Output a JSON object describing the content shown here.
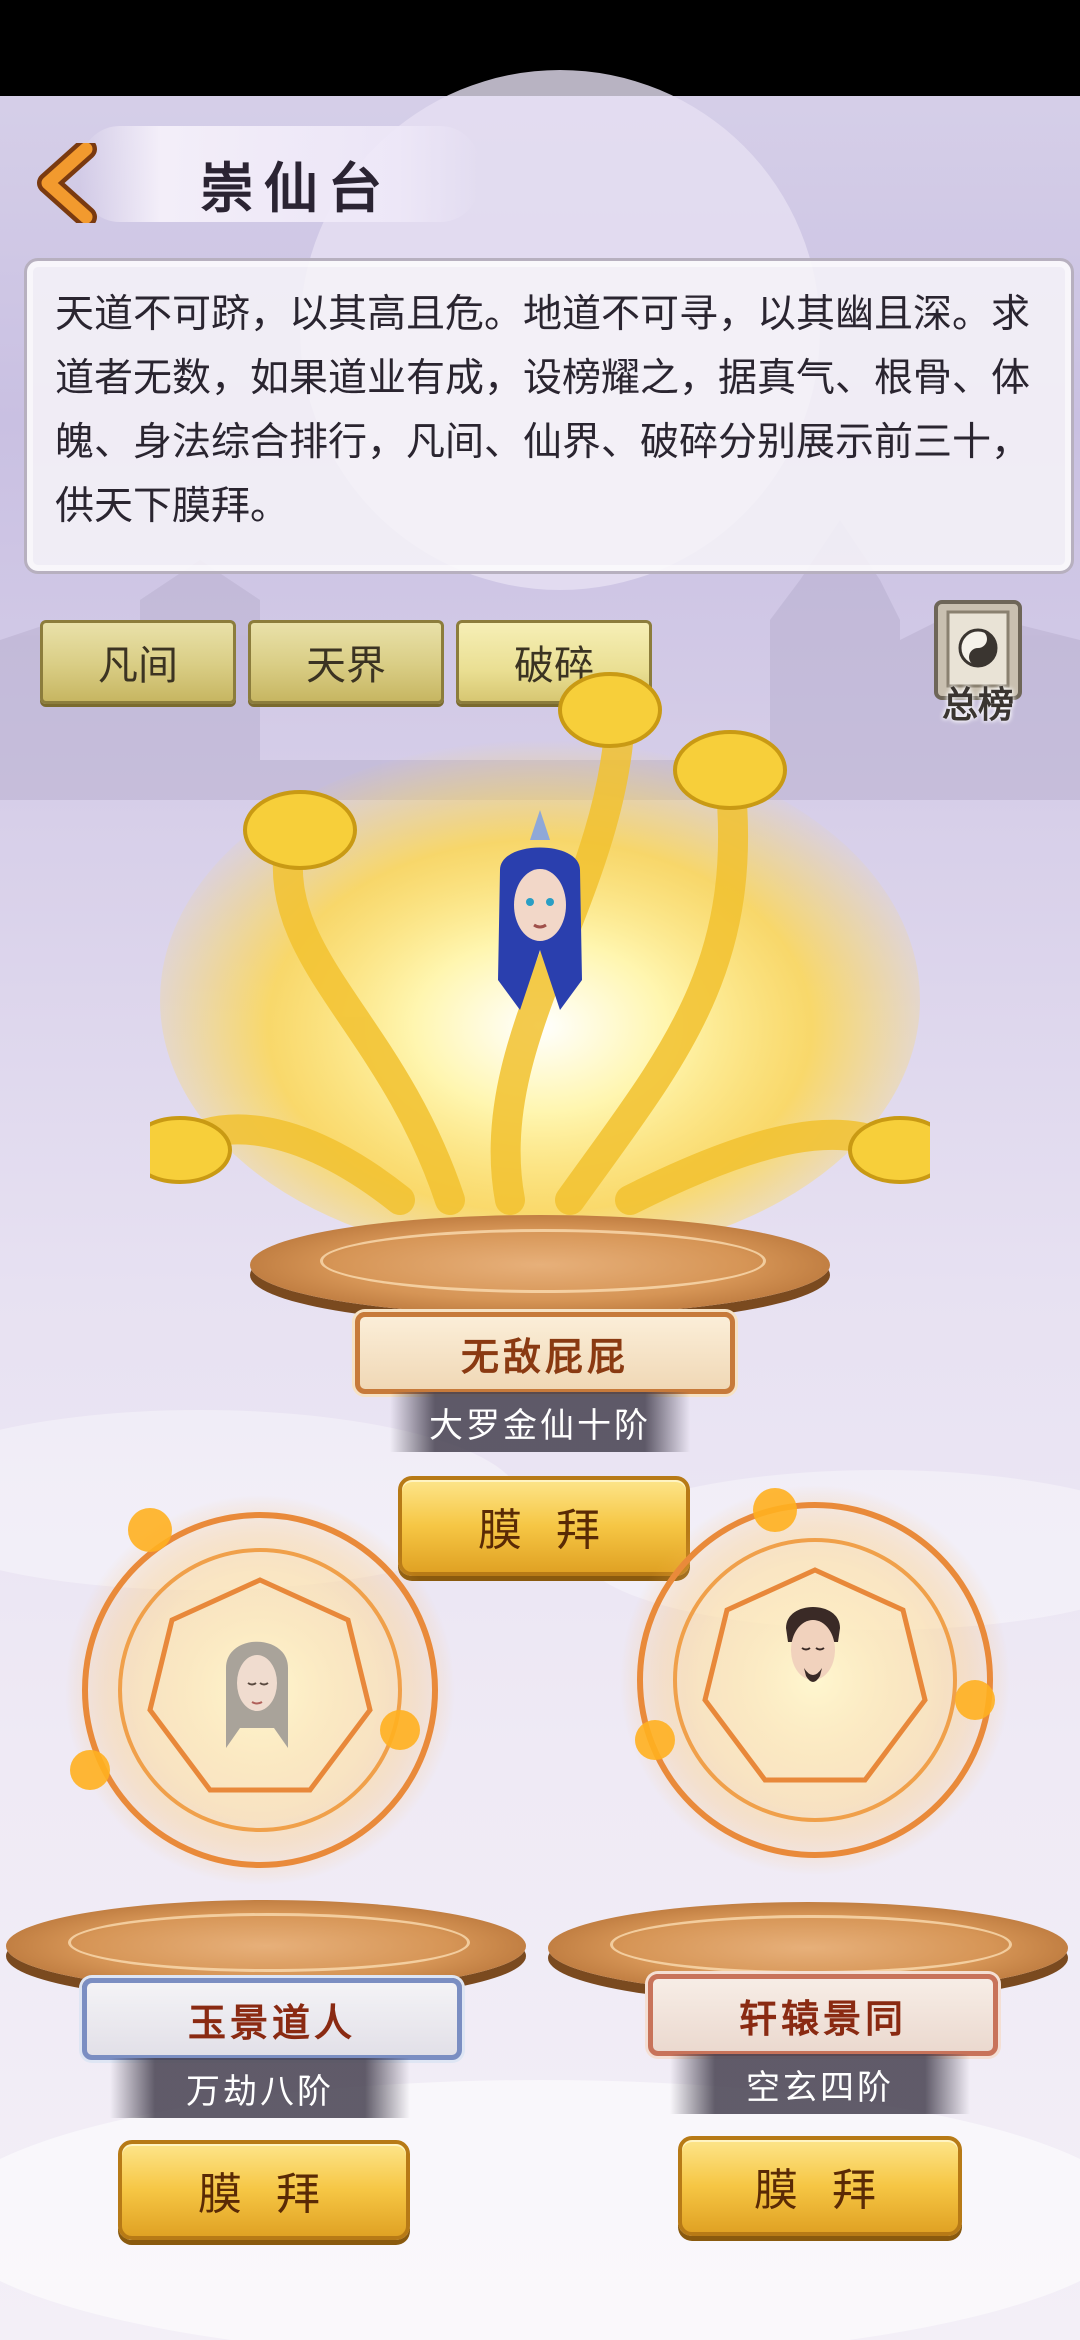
{
  "header": {
    "title": "崇仙台"
  },
  "description": "天道不可跻，以其高且危。地道不可寻，以其幽且深。求道者无数，如果道业有成，设榜耀之，据真气、根骨、体魄、身法综合排行，凡间、仙界、破碎分别展示前三十，供天下膜拜。",
  "tabs": [
    {
      "label": "凡间"
    },
    {
      "label": "天界"
    },
    {
      "label": "破碎"
    }
  ],
  "overall_button": {
    "label": "总榜"
  },
  "rank1": {
    "name": "无敌屁屁",
    "rank": "大罗金仙十阶",
    "button": "膜 拜"
  },
  "rank2": {
    "name": "玉景道人",
    "rank": "万劫八阶",
    "button": "膜 拜"
  },
  "rank3": {
    "name": "轩辕景同",
    "rank": "空玄四阶",
    "button": "膜 拜"
  },
  "colors": {
    "gold": "#f6c644",
    "accent": "#c0521e",
    "panel": "#f6f3f8"
  },
  "icons": {
    "back": "chevron-left-icon",
    "overall": "yin-yang-icon"
  }
}
